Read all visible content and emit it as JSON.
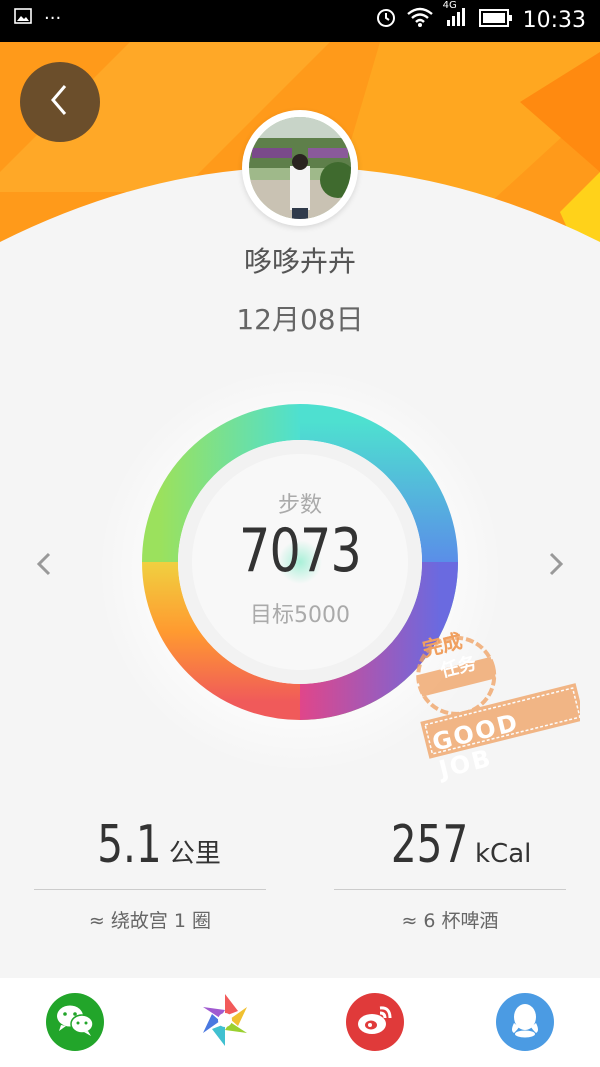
{
  "status_bar": {
    "time": "10:33",
    "network": "4G",
    "overflow": "···"
  },
  "profile": {
    "username": "哆哆卉卉",
    "date": "12月08日"
  },
  "ring": {
    "label": "步数",
    "value": "7073",
    "goal": "目标5000"
  },
  "stamp": {
    "line1": "完成",
    "line2": "任务",
    "line3": "GOOD JOB"
  },
  "stats": {
    "distance": {
      "value": "5.1",
      "unit": "公里",
      "equivalent": "≈ 绕故宫 1 圈"
    },
    "calories": {
      "value": "257",
      "unit": "kCal",
      "equivalent": "≈ 6 杯啤酒"
    }
  },
  "share": [
    {
      "name": "wechat-icon",
      "color": "#22a52a"
    },
    {
      "name": "moments-icon",
      "color": "#ffffff"
    },
    {
      "name": "weibo-icon",
      "color": "#e03a3a"
    },
    {
      "name": "qq-icon",
      "color": "#4b9be3"
    }
  ],
  "colors": {
    "header_orange": "#ff9a1a",
    "back_button": "#6b4e2b",
    "stamp_orange": "#f0a060"
  }
}
